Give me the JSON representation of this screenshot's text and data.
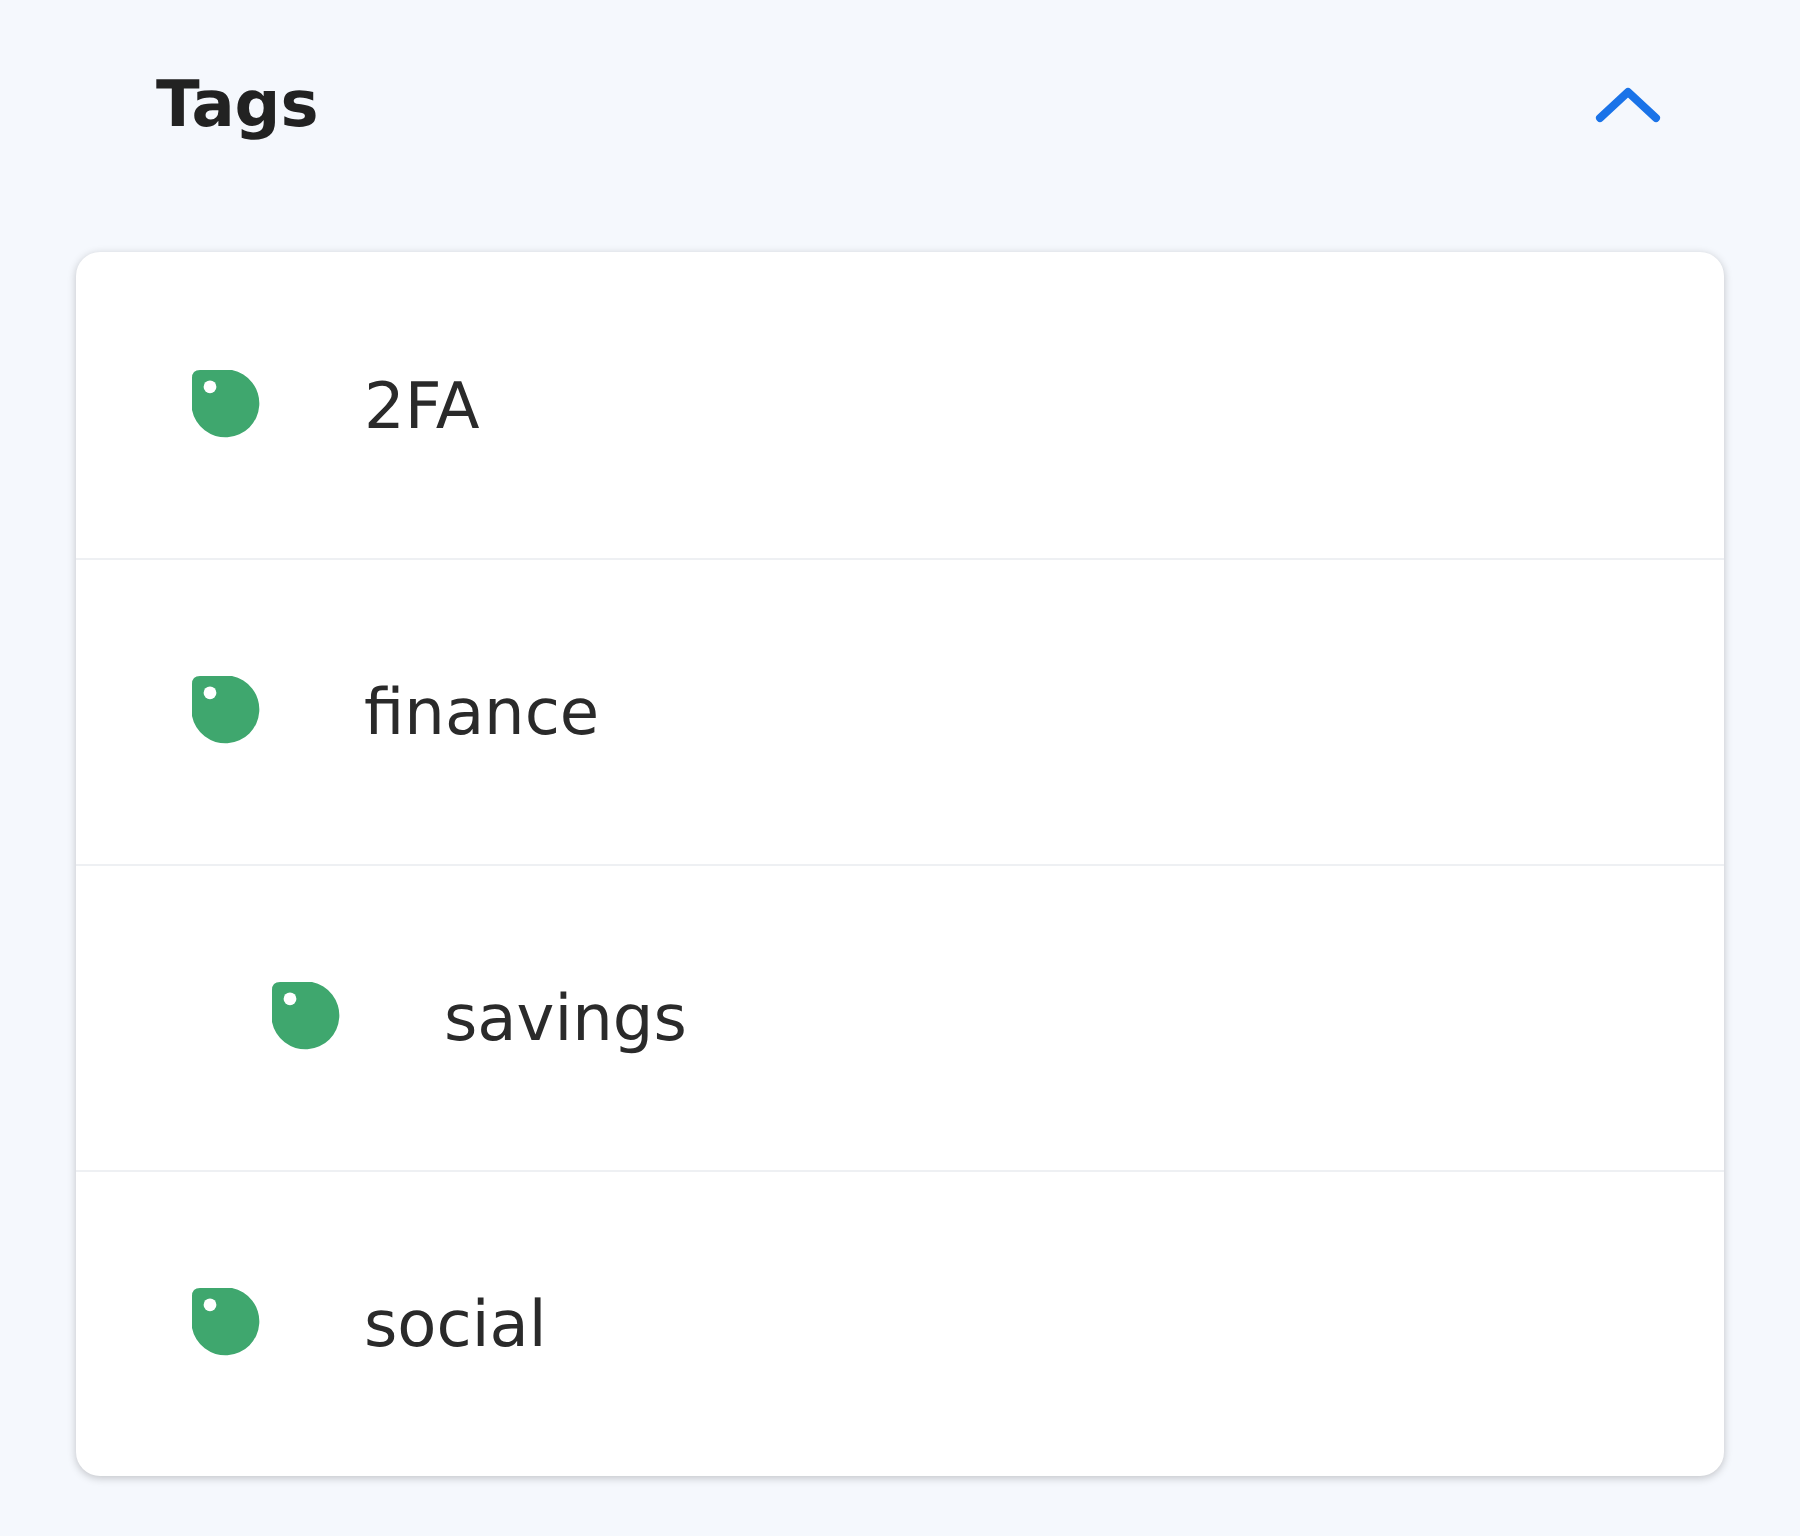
{
  "section": {
    "title": "Tags",
    "expanded": true
  },
  "tags": [
    {
      "label": "2FA"
    },
    {
      "label": "finance",
      "children": [
        {
          "label": "savings"
        }
      ]
    },
    {
      "label": "social"
    }
  ]
}
